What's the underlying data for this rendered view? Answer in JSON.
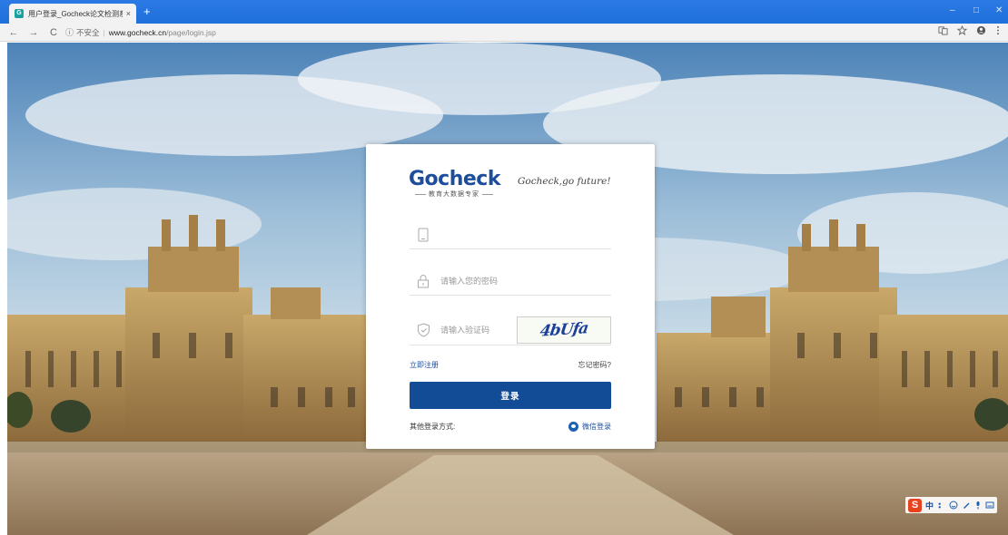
{
  "browser": {
    "tab_title": "用户登录_Gocheck论文检测系统",
    "tab_close": "×",
    "new_tab": "+",
    "window_controls": {
      "minimize": "–",
      "maximize": "□",
      "close": "✕"
    },
    "nav": {
      "back": "←",
      "forward": "→",
      "reload": "C"
    },
    "address": {
      "info_icon": "ⓘ",
      "insecure_label": "不安全",
      "separator": "|",
      "host": "www.gocheck.cn",
      "path": "/page/login.jsp"
    },
    "right_icons": [
      "translate-icon",
      "star-icon",
      "account-icon",
      "menu-icon"
    ]
  },
  "login": {
    "logo_text": "Gocheck",
    "logo_subtitle": "教育大数据专家",
    "slogan": "Gocheck,go future!",
    "phone_placeholder": "",
    "password_placeholder": "请输入您的密码",
    "captcha_placeholder": "请输入验证码",
    "captcha_code": "4bUfa",
    "register_link": "立即注册",
    "forgot_link": "忘记密码?",
    "login_button": "登录",
    "other_login_label": "其他登录方式:",
    "wechat_login": "微信登录"
  },
  "ime": {
    "logo": "S",
    "mode": "中",
    "icons": [
      "punctuation-icon",
      "emoji-icon",
      "pen-icon",
      "mic-icon",
      "keyboard-icon"
    ]
  },
  "colors": {
    "browser_blue": "#1f6fdc",
    "brand_blue": "#1d4e9b",
    "button_blue": "#124c96"
  }
}
